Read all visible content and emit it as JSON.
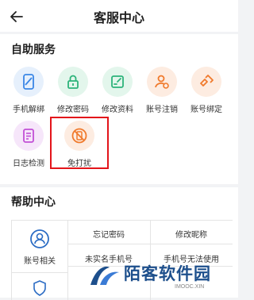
{
  "header": {
    "title": "客服中心"
  },
  "self_service": {
    "title": "自助服务",
    "items": [
      {
        "label": "手机解绑",
        "icon": "phone-unlink-icon",
        "color": "#3a86e6",
        "bg": "#e6f0fc"
      },
      {
        "label": "修改密码",
        "icon": "lock-icon",
        "color": "#2cb37a",
        "bg": "#e3f6ec"
      },
      {
        "label": "修改资料",
        "icon": "edit-profile-icon",
        "color": "#2cb37a",
        "bg": "#e3f6ec"
      },
      {
        "label": "账号注销",
        "icon": "account-cancel-icon",
        "color": "#f07a2c",
        "bg": "#fdece1"
      },
      {
        "label": "账号绑定",
        "icon": "account-link-icon",
        "color": "#f07a2c",
        "bg": "#fdece1"
      },
      {
        "label": "日志检测",
        "icon": "log-check-icon",
        "color": "#c24fd6",
        "bg": "#f6e6fa"
      },
      {
        "label": "免打扰",
        "icon": "do-not-disturb-icon",
        "color": "#f07a2c",
        "bg": "#fdece1"
      }
    ]
  },
  "help": {
    "title": "帮助中心",
    "category": "账号相关",
    "links": [
      "忘记密码",
      "修改昵称",
      "未实名手机号",
      "手机号无法使用"
    ]
  },
  "watermark": {
    "text": "陌客软件园",
    "sub": "IMOOC.XIN"
  }
}
